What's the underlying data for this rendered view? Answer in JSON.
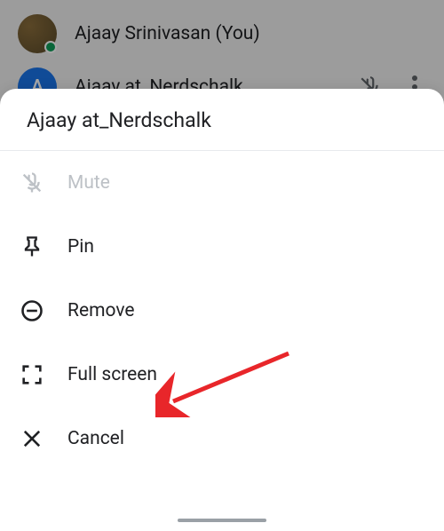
{
  "participants": [
    {
      "name": "Ajaay Srinivasan (You)",
      "initial": ""
    },
    {
      "name": "Ajaay at_Nerdschalk",
      "initial": "A"
    }
  ],
  "sheet": {
    "title": "Ajaay at_Nerdschalk",
    "items": {
      "mute": "Mute",
      "pin": "Pin",
      "remove": "Remove",
      "fullscreen": "Full screen",
      "cancel": "Cancel"
    }
  }
}
